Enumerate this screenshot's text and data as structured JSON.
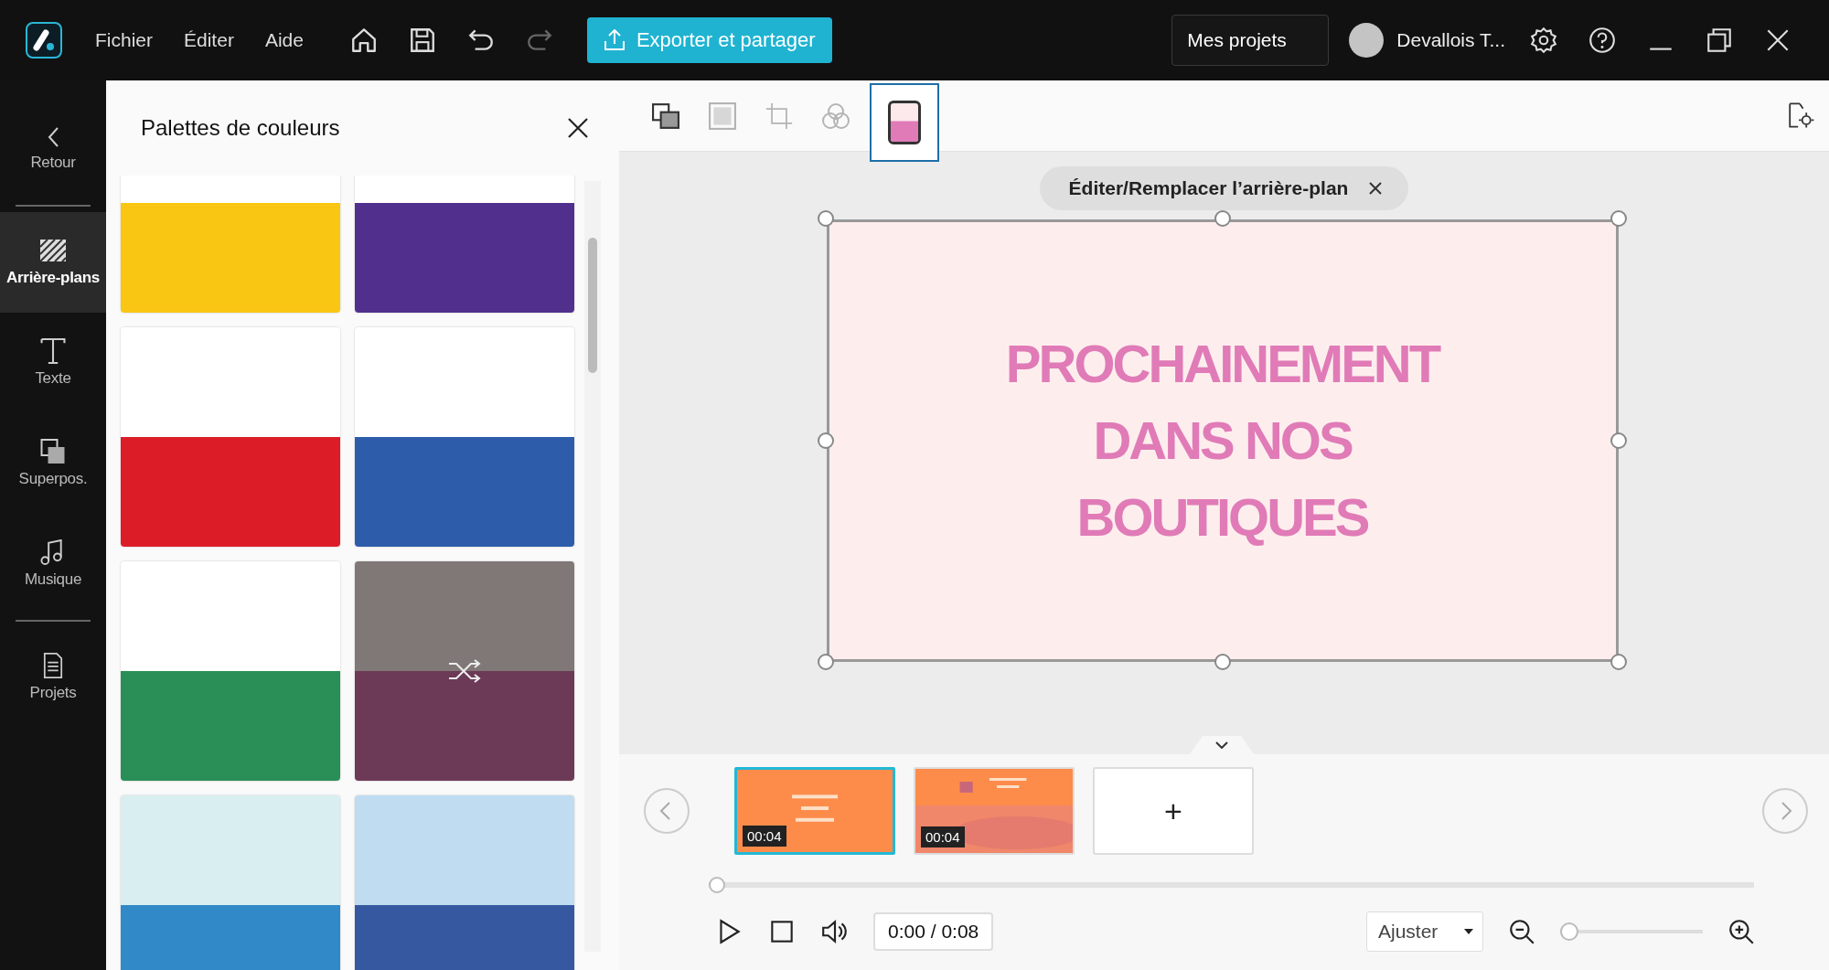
{
  "menu": [
    "Fichier",
    "Éditer",
    "Aide"
  ],
  "export_button": "Exporter et partager",
  "projects_button": "Mes projets",
  "user": {
    "name": "Devallois T..."
  },
  "nav": [
    {
      "kind": "back",
      "label": "Retour",
      "selected": false
    },
    {
      "kind": "backgrounds",
      "label": "Arrière-plans",
      "selected": true
    },
    {
      "kind": "text",
      "label": "Texte",
      "selected": false
    },
    {
      "kind": "overlays",
      "label": "Superpos.",
      "selected": false
    },
    {
      "kind": "music",
      "label": "Musique",
      "selected": false
    },
    {
      "kind": "projects",
      "label": "Projets",
      "selected": false
    }
  ],
  "panel": {
    "title": "Palettes de couleurs",
    "palettes": [
      {
        "kind": "palette",
        "swatches": [
          {
            "color": "#ffffff"
          },
          {
            "color": "#f9c613"
          }
        ]
      },
      {
        "kind": "palette",
        "swatches": [
          {
            "color": "#ffffff"
          },
          {
            "color": "#51308d"
          }
        ]
      },
      {
        "kind": "palette",
        "swatches": [
          {
            "color": "#ffffff"
          },
          {
            "color": "#dc1d28"
          }
        ]
      },
      {
        "kind": "palette",
        "swatches": [
          {
            "color": "#ffffff"
          },
          {
            "color": "#2d5cab"
          }
        ]
      },
      {
        "kind": "palette",
        "swatches": [
          {
            "color": "#ffffff"
          },
          {
            "color": "#2a8f57"
          }
        ]
      },
      {
        "kind": "shuffle",
        "swatches": [
          {
            "color": "#807777"
          },
          {
            "color": "#6c3a56"
          }
        ]
      },
      {
        "kind": "palette",
        "swatches": [
          {
            "color": "#d8eef0"
          },
          {
            "color": "#3189c8"
          }
        ]
      },
      {
        "kind": "palette",
        "swatches": [
          {
            "color": "#bfdcf0"
          },
          {
            "color": "#3558a1"
          }
        ]
      }
    ]
  },
  "tools": [
    {
      "kind": "layers",
      "selected": false,
      "disabled": false
    },
    {
      "kind": "frame",
      "selected": false,
      "disabled": true
    },
    {
      "kind": "crop",
      "selected": false,
      "disabled": true
    },
    {
      "kind": "filters",
      "selected": false,
      "disabled": true
    },
    {
      "kind": "fill",
      "selected": true,
      "disabled": false
    }
  ],
  "canvas": {
    "hint": "Éditer/Remplacer l’arrière-plan",
    "slide_lines": [
      "PROCHAINEMENT",
      "DANS NOS",
      "BOUTIQUES"
    ]
  },
  "timeline": {
    "slides": [
      {
        "kind": "picture",
        "duration": "00:04",
        "selected": true
      },
      {
        "kind": "picture",
        "duration": "00:04",
        "selected": false
      }
    ],
    "add_label": "+",
    "scrubber": {
      "level": 0
    },
    "time": "0:00 / 0:08",
    "fit": "Ajuster",
    "zoom": {
      "level": 0
    }
  }
}
